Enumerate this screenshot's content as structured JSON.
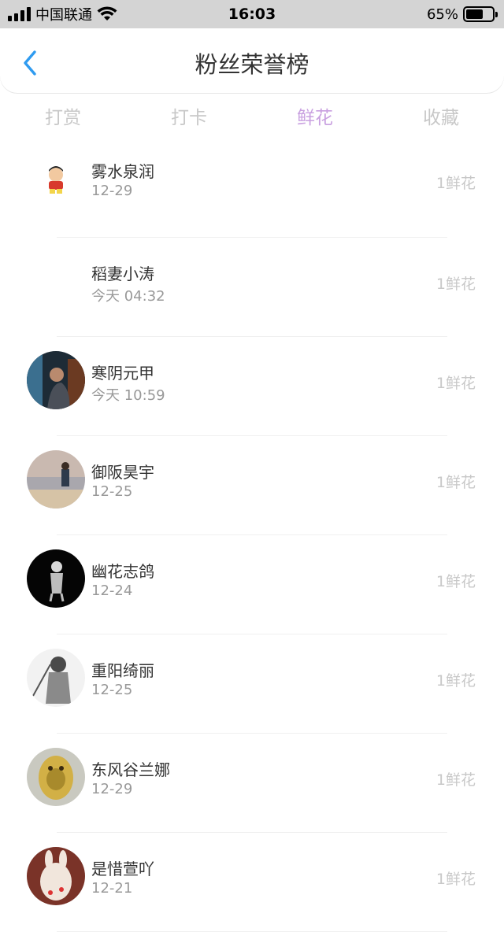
{
  "status_bar": {
    "carrier": "中国联通",
    "time": "16:03",
    "battery": "65%",
    "battery_level": 0.65
  },
  "nav": {
    "title": "粉丝荣誉榜",
    "back_icon": "chevron-left-icon"
  },
  "tabs": [
    {
      "label": "打赏",
      "active": false
    },
    {
      "label": "打卡",
      "active": false
    },
    {
      "label": "鲜花",
      "active": true
    },
    {
      "label": "收藏",
      "active": false
    }
  ],
  "fans": [
    {
      "name": "雾水泉润",
      "date": "12-29",
      "count": "1鲜花",
      "avatar": "cartoon-sticker"
    },
    {
      "name": "稻妻小涛",
      "date": "今天 04:32",
      "count": "1鲜花",
      "avatar": "none"
    },
    {
      "name": "寒阴元甲",
      "date": "今天 10:59",
      "count": "1鲜花",
      "avatar": "photo-dark-window"
    },
    {
      "name": "御阪昊宇",
      "date": "12-25",
      "count": "1鲜花",
      "avatar": "photo-sunset"
    },
    {
      "name": "幽花志鸽",
      "date": "12-24",
      "count": "1鲜花",
      "avatar": "photo-black-white"
    },
    {
      "name": "重阳绮丽",
      "date": "12-25",
      "count": "1鲜花",
      "avatar": "sketch-gray"
    },
    {
      "name": "东风谷兰娜",
      "date": "12-29",
      "count": "1鲜花",
      "avatar": "figurine-yellow"
    },
    {
      "name": "是惜萱吖",
      "date": "12-21",
      "count": "1鲜花",
      "avatar": "photo-red-bunny"
    }
  ],
  "colors": {
    "accent": "#c9a1e0",
    "back": "#2f9bf0",
    "inactive": "#c8c8c8"
  }
}
